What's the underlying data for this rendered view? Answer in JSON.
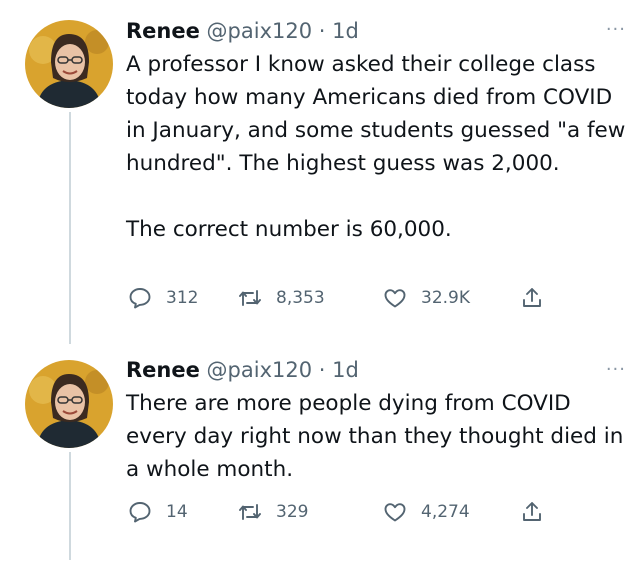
{
  "tweets": [
    {
      "name": "Renee",
      "handle": "@paix120",
      "sep": " · ",
      "time": "1d",
      "more": "···",
      "text": "A professor I know asked their college class today how many Americans died from COVID in January, and some students guessed \"a few hundred\". The highest guess was 2,000.\n\nThe correct number is 60,000.",
      "replies": "312",
      "retweets": "8,353",
      "likes": "32.9K",
      "avatar_icon": "person-avatar-icon"
    },
    {
      "name": "Renee",
      "handle": "@paix120",
      "sep": " · ",
      "time": "1d",
      "more": "···",
      "text": "There are more people dying from COVID every day right now than they thought died in a whole month.",
      "replies": "14",
      "retweets": "329",
      "likes": "4,274",
      "avatar_icon": "person-avatar-icon"
    }
  ],
  "colors": {
    "text": "#0f1419",
    "secondary": "#536471",
    "thread_line": "#cfd9de",
    "avatar_bg": "#d9a32e"
  },
  "icons": [
    "reply-icon",
    "retweet-icon",
    "like-icon",
    "share-icon",
    "more-icon"
  ]
}
